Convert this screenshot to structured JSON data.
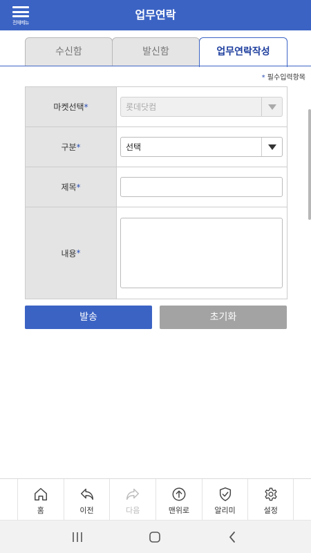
{
  "header": {
    "menu_label": "전체메뉴",
    "title": "업무연락"
  },
  "tabs": [
    {
      "label": "수신함",
      "active": false
    },
    {
      "label": "발신함",
      "active": false
    },
    {
      "label": "업무연락작성",
      "active": true
    }
  ],
  "required_note": {
    "star": "*",
    "text": "필수입력항목"
  },
  "form": {
    "market": {
      "label": "마켓선택",
      "star": "*",
      "value": "롯데닷컴"
    },
    "category": {
      "label": "구분",
      "star": "*",
      "value": "선택"
    },
    "subject": {
      "label": "제목",
      "star": "*",
      "value": ""
    },
    "content": {
      "label": "내용",
      "star": "*",
      "value": ""
    }
  },
  "buttons": {
    "send": "발송",
    "reset": "초기화"
  },
  "bottom_nav": [
    {
      "label": "홈",
      "icon": "home-icon",
      "disabled": false
    },
    {
      "label": "이전",
      "icon": "back-arrow-icon",
      "disabled": false
    },
    {
      "label": "다음",
      "icon": "forward-arrow-icon",
      "disabled": true
    },
    {
      "label": "맨위로",
      "icon": "arrow-up-circle-icon",
      "disabled": false
    },
    {
      "label": "알리미",
      "icon": "shield-check-icon",
      "disabled": false
    },
    {
      "label": "설정",
      "icon": "gear-icon",
      "disabled": false
    }
  ],
  "colors": {
    "primary": "#3b63c4",
    "reset_button": "#a3a3a3",
    "label_bg": "#e4e4e4"
  }
}
